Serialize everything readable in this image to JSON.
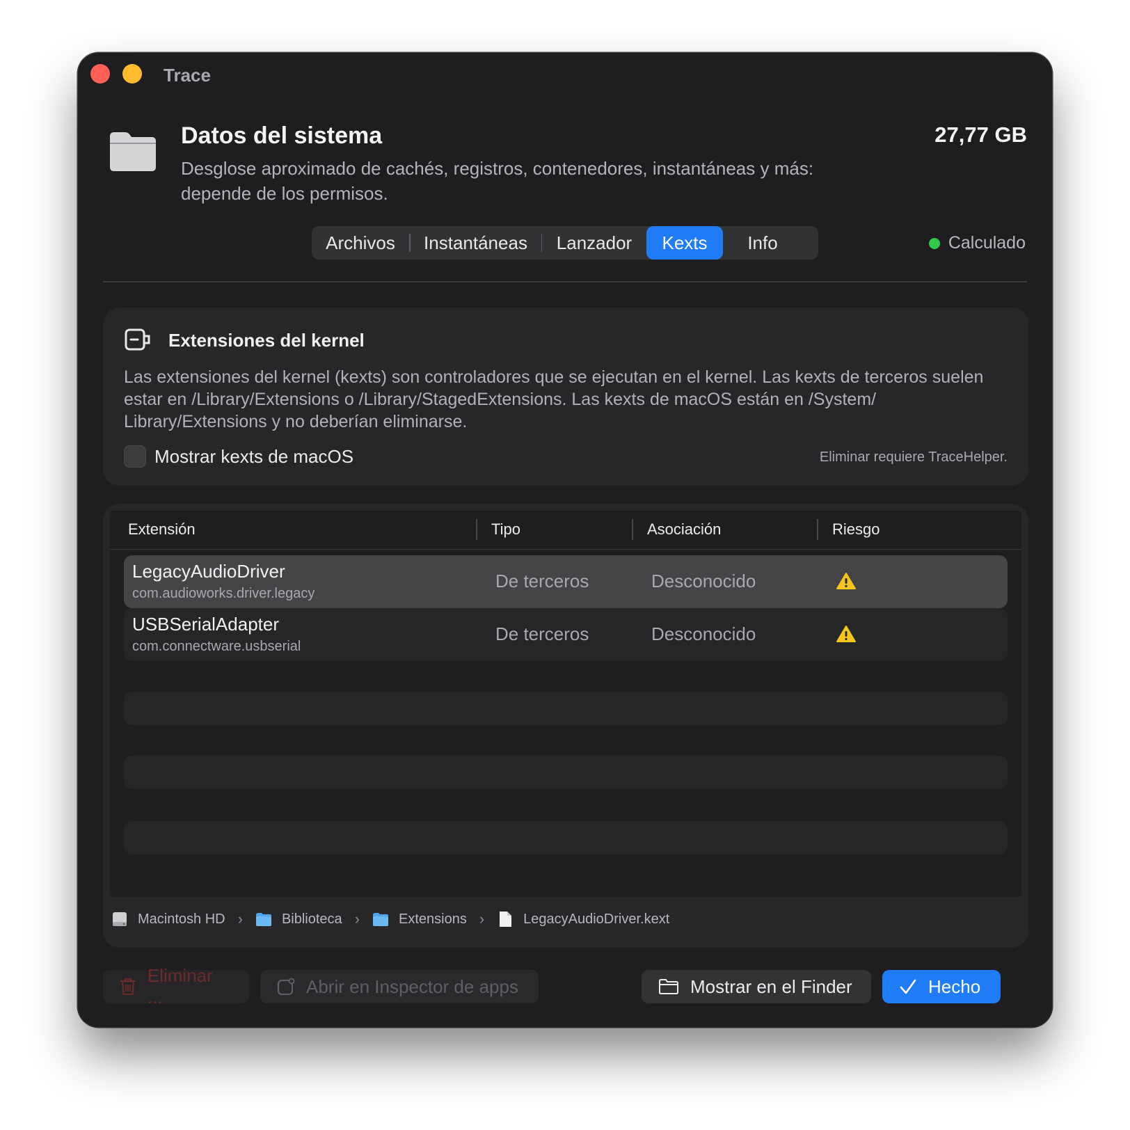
{
  "window": {
    "title": "Trace"
  },
  "header": {
    "title": "Datos del sistema",
    "description": "Desglose aproximado de cachés, registros, contenedores, instantáneas y más: depende de los permisos.",
    "size": "27,77 GB"
  },
  "tabs": [
    {
      "label": "Archivos",
      "active": false
    },
    {
      "label": "Instantáneas",
      "active": false
    },
    {
      "label": "Lanzador",
      "active": false
    },
    {
      "label": "Kexts",
      "active": true
    },
    {
      "label": "Info",
      "active": false
    }
  ],
  "status": {
    "label": "Calculado",
    "color": "#30c94a"
  },
  "kexts_card": {
    "title": "Extensiones del kernel",
    "description": "Las extensiones del kernel (kexts) son controladores que se ejecutan en el kernel. Las kexts de terceros suelen estar en /Library/Extensions o /Library/StagedExtensions. Las kexts de macOS están en /System/ Library/Extensions y no deberían eliminarse.",
    "checkbox_label": "Mostrar kexts de macOS",
    "checkbox_checked": false,
    "note": "Eliminar requiere TraceHelper."
  },
  "table": {
    "columns": [
      "Extensión",
      "Tipo",
      "Asociación",
      "Riesgo"
    ],
    "rows": [
      {
        "name": "LegacyAudioDriver",
        "bundle_id": "com.audioworks.driver.legacy",
        "tipo": "De terceros",
        "asociacion": "Desconocido",
        "riesgo": "warning-icon",
        "selected": true
      },
      {
        "name": "USBSerialAdapter",
        "bundle_id": "com.connectware.usbserial",
        "tipo": "De terceros",
        "asociacion": "Desconocido",
        "riesgo": "warning-icon",
        "selected": false
      }
    ]
  },
  "breadcrumb": [
    {
      "label": "Macintosh HD",
      "icon": "disk-icon"
    },
    {
      "label": "Biblioteca",
      "icon": "folder-icon"
    },
    {
      "label": "Extensions",
      "icon": "folder-icon"
    },
    {
      "label": "LegacyAudioDriver.kext",
      "icon": "file-icon"
    }
  ],
  "buttons": {
    "delete": "Eliminar ...",
    "inspect": "Abrir en Inspector de apps",
    "finder": "Mostrar en el Finder",
    "done": "Hecho"
  },
  "colors": {
    "accent": "#1f7cf6",
    "close": "#ff5f57",
    "minimize": "#febc2e",
    "warning": "#f5c518"
  }
}
